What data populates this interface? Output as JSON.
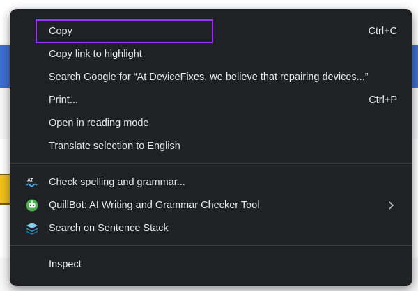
{
  "menu": {
    "items": [
      {
        "label": "Copy",
        "shortcut": "Ctrl+C"
      },
      {
        "label": "Copy link to highlight"
      },
      {
        "label": "Search Google for “At DeviceFixes, we believe that repairing devices...”"
      },
      {
        "label": "Print...",
        "shortcut": "Ctrl+P"
      },
      {
        "label": "Open in reading mode"
      },
      {
        "label": "Translate selection to English"
      },
      {
        "label": "Check spelling and grammar...",
        "icon": "spell-check-icon"
      },
      {
        "label": "QuillBot: AI Writing and Grammar Checker Tool",
        "icon": "quillbot-icon",
        "submenu": true
      },
      {
        "label": "Search on Sentence Stack",
        "icon": "sentence-stack-icon"
      },
      {
        "label": "Inspect"
      }
    ]
  },
  "colors": {
    "menu_bg": "#202124",
    "menu_text": "#e8eaed",
    "focus_outline": "#9b34f0",
    "separator": "#3c4043",
    "page_highlight": "#3d6fd2"
  }
}
